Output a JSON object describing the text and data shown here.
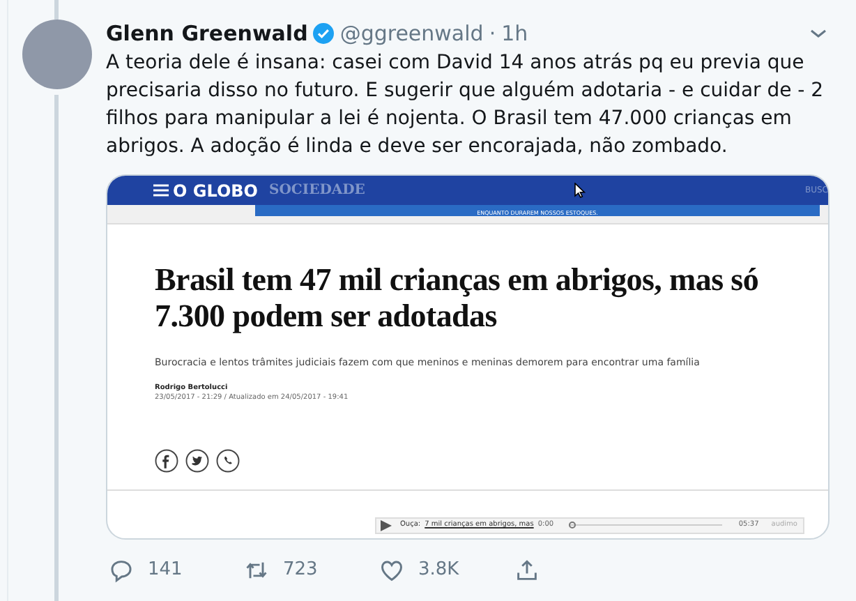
{
  "tweet": {
    "name": "Glenn Greenwald",
    "verified": true,
    "handle": "@ggreenwald",
    "separator": "·",
    "time": "1h",
    "text": "A teoria dele é insana: casei com David 14 anos atrás pq eu previa que precisaria disso no futuro. E sugerir que alguém adotaria - e cuidar de - 2 filhos para manipular a lei é nojenta. O Brasil tem 47.000 crianças em abrigos. A adoção é linda e deve ser encorajada, não zombado."
  },
  "embed": {
    "site_logo": "O GLOBO",
    "section": "SOCIEDADE",
    "search_label": "BUSC",
    "ad_text": "ENQUANTO DURAREM NOSSOS ESTOQUES.",
    "headline": "Brasil tem 47 mil crianças em abrigos, mas só 7.300 podem ser adotadas",
    "subtitle": "Burocracia e lentos trâmites judiciais fazem com que meninos e meninas demorem para encontrar uma família",
    "author": "Rodrigo Bertolucci",
    "dates": "23/05/2017 - 21:29 / Atualizado em 24/05/2017 - 19:41",
    "share": [
      {
        "kind": "facebook"
      },
      {
        "kind": "twitter"
      },
      {
        "kind": "whatsapp"
      }
    ],
    "audio": {
      "label": "Ouça:",
      "title": "7 mil crianças em abrigos, mas",
      "elapsed": "0:00",
      "duration": "05:37",
      "brand": "audimo",
      "level": 0
    }
  },
  "actions": [
    {
      "kind": "reply",
      "count": "141"
    },
    {
      "kind": "retweet",
      "count": "723"
    },
    {
      "kind": "like",
      "count": "3.8K"
    },
    {
      "kind": "share"
    }
  ]
}
